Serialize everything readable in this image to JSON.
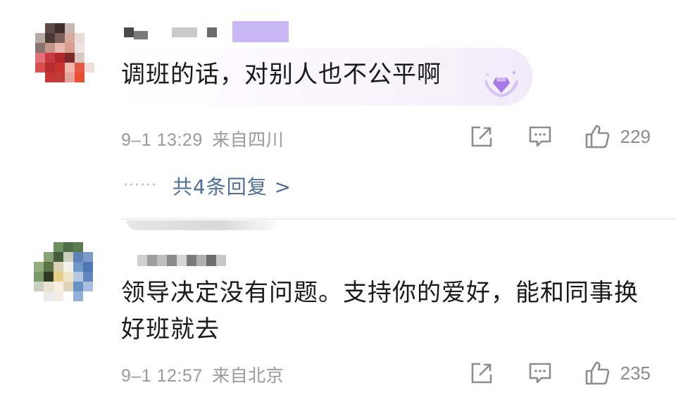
{
  "comments": [
    {
      "text": "调班的话，对别人也不公平啊",
      "time": "9–1 13:29",
      "location": "来自四川",
      "likes": "229",
      "replies_label": "共4条回复 >",
      "has_badge": true,
      "badge_icon": "diamond-crown-icon"
    },
    {
      "text": "领导决定没有问题。支持你的爱好，能和同事换好班就去",
      "time": "9–1 12:57",
      "location": "来自北京",
      "likes": "235"
    }
  ],
  "colors": {
    "text": "#1a1a1a",
    "meta": "#9a9a9a",
    "link": "#4f6f95",
    "badge": "#b48be8"
  },
  "icons": {
    "share": "share-icon",
    "reply": "comment-icon",
    "like": "thumbs-up-icon"
  }
}
